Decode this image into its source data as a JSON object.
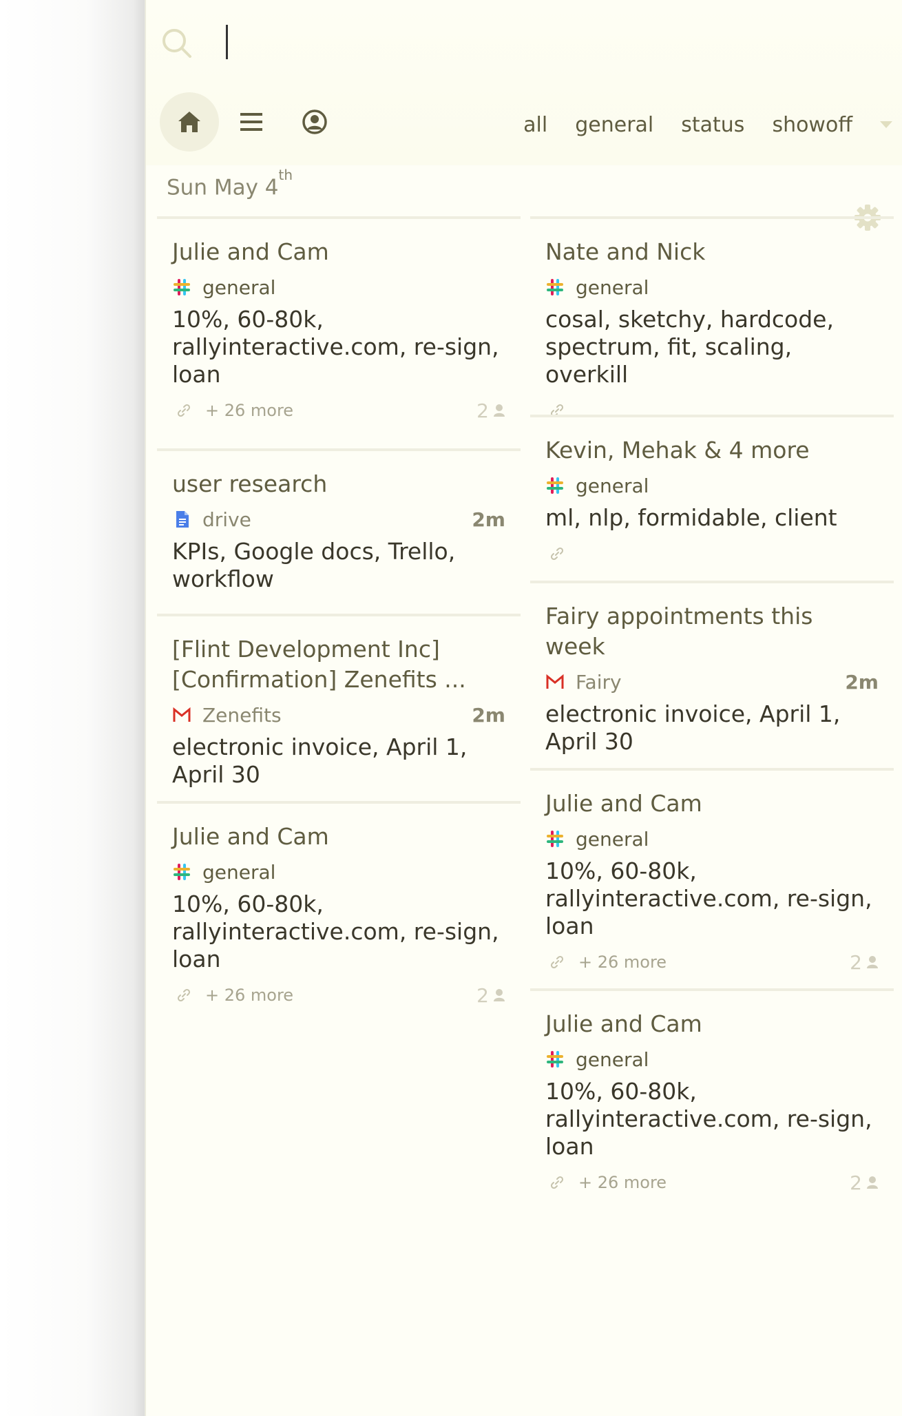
{
  "search": {
    "placeholder": "",
    "value": ""
  },
  "nav": {
    "home": "home-icon",
    "list": "list-icon",
    "profile": "profile-icon"
  },
  "tabs": [
    "all",
    "general",
    "status",
    "showoff"
  ],
  "date": {
    "day": "Sun May 4",
    "suffix": "th"
  },
  "colors": {
    "panel_bg": "#fefef6",
    "accent": "#5f5c40",
    "active_nav": "#f1f0de",
    "divider": "#efeee0"
  },
  "cards": [
    {
      "title": "Julie and Cam",
      "source_icon": "slack-icon",
      "source": "general",
      "time": "",
      "keywords": "10%, 60-80k, rallyinteractive.com, re-sign, loan",
      "more": "+ 26 more",
      "count": "2"
    },
    {
      "title": "user research",
      "source_icon": "drive-icon",
      "source": "drive",
      "time": "2m",
      "keywords": "KPIs, Google docs, Trello, workflow"
    },
    {
      "title": "[Flint Development Inc] [Confirmation] Zenefits ...",
      "source_icon": "gmail-icon",
      "source": "Zenefits",
      "time": "2m",
      "keywords": "electronic invoice, April 1, April 30"
    },
    {
      "title": "Julie and Cam",
      "source_icon": "slack-icon",
      "source": "general",
      "time": "",
      "keywords": "10%, 60-80k, rallyinteractive.com, re-sign, loan",
      "more": "+ 26 more",
      "count": "2"
    },
    {
      "title": "Nate and Nick",
      "source_icon": "slack-icon",
      "source": "general",
      "time": "",
      "keywords": "cosal, sketchy, hardcode, spectrum, fit, scaling, overkill"
    },
    {
      "title": "Kevin, Mehak & 4 more",
      "source_icon": "slack-icon",
      "source": "general",
      "time": "",
      "keywords": "ml, nlp, formidable, client"
    },
    {
      "title": "Fairy appointments this week",
      "source_icon": "gmail-icon",
      "source": "Fairy",
      "time": "2m",
      "keywords": "electronic invoice, April 1, April 30"
    },
    {
      "title": "Julie and Cam",
      "source_icon": "slack-icon",
      "source": "general",
      "time": "",
      "keywords": "10%, 60-80k, rallyinteractive.com, re-sign, loan",
      "more": "+ 26 more",
      "count": "2"
    },
    {
      "title": "Julie and Cam",
      "source_icon": "slack-icon",
      "source": "general",
      "time": "",
      "keywords": "10%, 60-80k, rallyinteractive.com, re-sign, loan",
      "more": "+ 26 more",
      "count": "2"
    }
  ]
}
